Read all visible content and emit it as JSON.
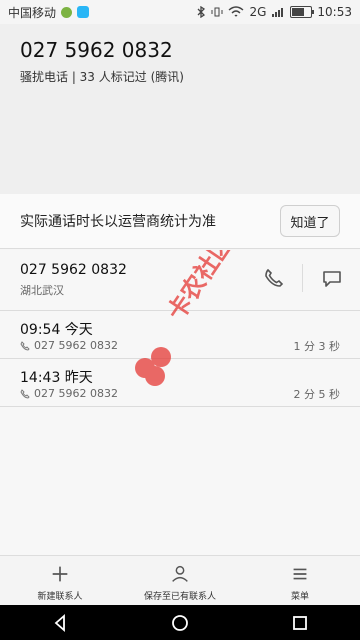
{
  "status": {
    "carrier": "中国移动",
    "network": "2G",
    "time": "10:53",
    "battery_level": 0.68
  },
  "header": {
    "number": "027 5962 0832",
    "tag": "骚扰电话 | 33 人标记过 (腾讯)"
  },
  "notice": {
    "text": "实际通话时长以运营商统计为准",
    "button": "知道了"
  },
  "contact": {
    "number": "027 5962 0832",
    "location": "湖北武汉"
  },
  "calls": [
    {
      "time": "09:54 今天",
      "number": "027 5962 0832",
      "duration": "1 分 3 秒"
    },
    {
      "time": "14:43 昨天",
      "number": "027 5962 0832",
      "duration": "2 分 5 秒"
    }
  ],
  "actions": [
    {
      "label": "新建联系人",
      "icon": "plus-icon"
    },
    {
      "label": "保存至已有联系人",
      "icon": "person-icon"
    },
    {
      "label": "菜单",
      "icon": "menu-icon"
    }
  ],
  "watermark": {
    "text": "卡农社区"
  },
  "colors": {
    "watermark": "#e53935"
  }
}
